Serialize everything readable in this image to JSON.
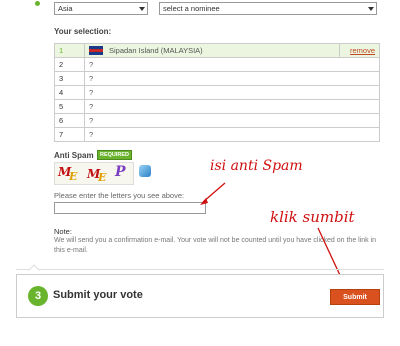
{
  "selectors": {
    "region": "Asia",
    "nominee": "select a nominee"
  },
  "selection": {
    "heading": "Your selection:",
    "rows": [
      {
        "num": "1",
        "name": "Sipadan Island (MALAYSIA)",
        "remove": "remove"
      },
      {
        "num": "2",
        "name": "?"
      },
      {
        "num": "3",
        "name": "?"
      },
      {
        "num": "4",
        "name": "?"
      },
      {
        "num": "5",
        "name": "?"
      },
      {
        "num": "6",
        "name": "?"
      },
      {
        "num": "7",
        "name": "?"
      }
    ]
  },
  "antispam": {
    "label": "Anti Spam",
    "required_badge": "REQUIRED",
    "captcha_letters": "MEMEP",
    "prompt": "Please enter the letters you see above:",
    "input_value": ""
  },
  "note": {
    "label": "Note:",
    "text": "We will send you a confirmation e-mail. Your vote will not be counted until you have clicked on the link in this e-mail."
  },
  "annotations": {
    "antispam_hint": "isi anti Spam",
    "submit_hint": "klik sumbit",
    "color": "#d01010"
  },
  "step": {
    "number": "3",
    "title": "Submit your vote",
    "submit_label": "Submit"
  },
  "colors": {
    "accent_green": "#6ab42d",
    "submit_orange": "#d9511f",
    "link": "#c04a23"
  }
}
